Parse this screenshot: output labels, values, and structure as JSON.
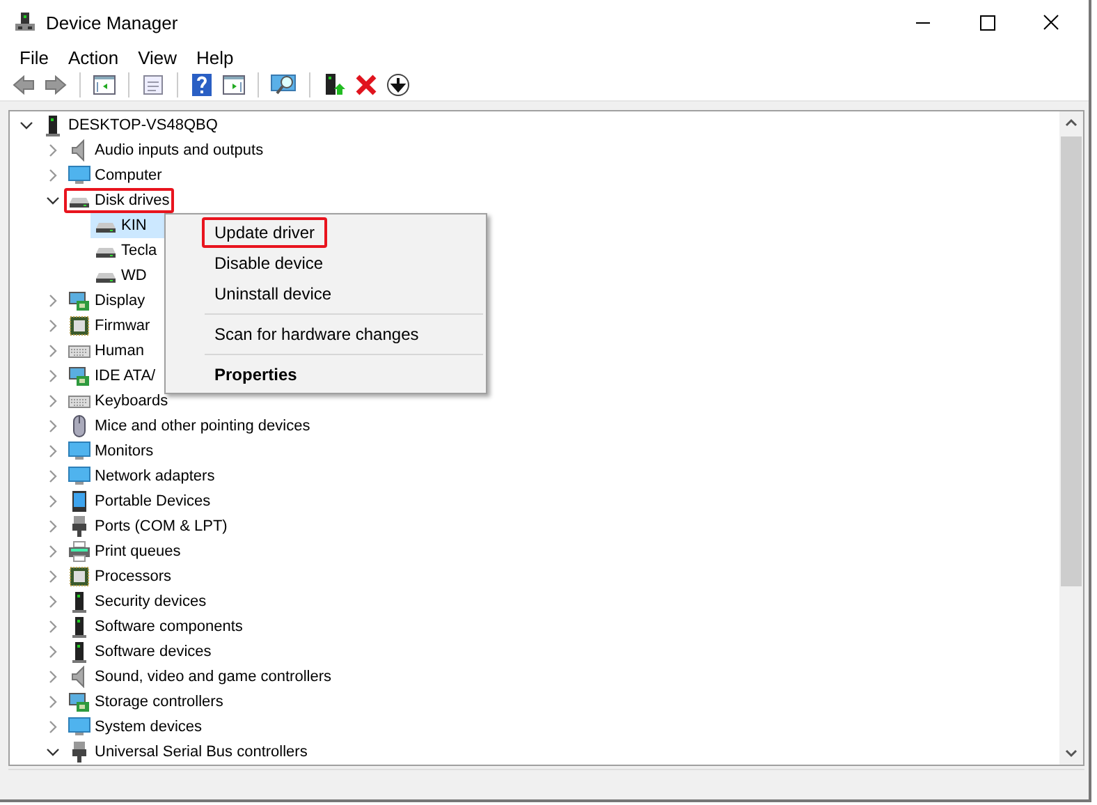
{
  "window": {
    "title": "Device Manager"
  },
  "menu_bar": [
    "File",
    "Action",
    "View",
    "Help"
  ],
  "tree": {
    "label": "DESKTOP-VS48QBQ",
    "expanded": true,
    "selected": false,
    "highlighted": false,
    "children": [
      {
        "label": "Audio inputs and outputs",
        "expanded": false,
        "selected": false,
        "highlighted": false
      },
      {
        "label": "Computer",
        "expanded": false,
        "selected": false,
        "highlighted": false
      },
      {
        "label": "Disk drives",
        "expanded": true,
        "selected": false,
        "highlighted": true,
        "children": [
          {
            "label": "KIN",
            "selected": true,
            "highlighted": false
          },
          {
            "label": "Tecla",
            "selected": false,
            "highlighted": false
          },
          {
            "label": "WD",
            "selected": false,
            "highlighted": false
          }
        ]
      },
      {
        "label": "Display",
        "expanded": false,
        "selected": false,
        "highlighted": false
      },
      {
        "label": "Firmwar",
        "expanded": false,
        "selected": false,
        "highlighted": false
      },
      {
        "label": "Human",
        "expanded": false,
        "selected": false,
        "highlighted": false
      },
      {
        "label": "IDE ATA/",
        "expanded": false,
        "selected": false,
        "highlighted": false
      },
      {
        "label": "Keyboards",
        "expanded": false,
        "selected": false,
        "highlighted": false
      },
      {
        "label": "Mice and other pointing devices",
        "expanded": false,
        "selected": false,
        "highlighted": false
      },
      {
        "label": "Monitors",
        "expanded": false,
        "selected": false,
        "highlighted": false
      },
      {
        "label": "Network adapters",
        "expanded": false,
        "selected": false,
        "highlighted": false
      },
      {
        "label": "Portable Devices",
        "expanded": false,
        "selected": false,
        "highlighted": false
      },
      {
        "label": "Ports (COM & LPT)",
        "expanded": false,
        "selected": false,
        "highlighted": false
      },
      {
        "label": "Print queues",
        "expanded": false,
        "selected": false,
        "highlighted": false
      },
      {
        "label": "Processors",
        "expanded": false,
        "selected": false,
        "highlighted": false
      },
      {
        "label": "Security devices",
        "expanded": false,
        "selected": false,
        "highlighted": false
      },
      {
        "label": "Software components",
        "expanded": false,
        "selected": false,
        "highlighted": false
      },
      {
        "label": "Software devices",
        "expanded": false,
        "selected": false,
        "highlighted": false
      },
      {
        "label": "Sound, video and game controllers",
        "expanded": false,
        "selected": false,
        "highlighted": false
      },
      {
        "label": "Storage controllers",
        "expanded": false,
        "selected": false,
        "highlighted": false
      },
      {
        "label": "System devices",
        "expanded": false,
        "selected": false,
        "highlighted": false
      },
      {
        "label": "Universal Serial Bus controllers",
        "expanded": true,
        "selected": false,
        "highlighted": false
      }
    ]
  },
  "context_menu": [
    {
      "kind": "item",
      "label": "Update driver",
      "highlighted": true,
      "default": false
    },
    {
      "kind": "item",
      "label": "Disable device",
      "highlighted": false,
      "default": false
    },
    {
      "kind": "item",
      "label": "Uninstall device",
      "highlighted": false,
      "default": false
    },
    {
      "kind": "separator"
    },
    {
      "kind": "item",
      "label": "Scan for hardware changes",
      "highlighted": false,
      "default": false
    },
    {
      "kind": "separator"
    },
    {
      "kind": "item",
      "label": "Properties",
      "highlighted": false,
      "default": true
    }
  ]
}
